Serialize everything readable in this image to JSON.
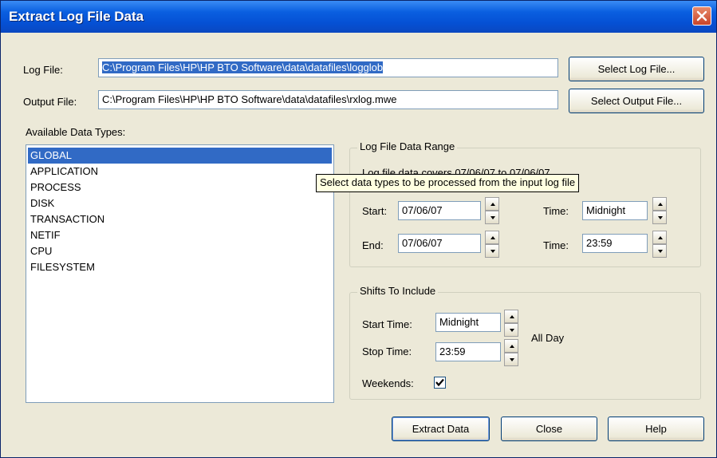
{
  "window": {
    "title": "Extract Log File Data"
  },
  "log_file": {
    "label": "Log File:",
    "value": "C:\\Program Files\\HP\\HP BTO Software\\data\\datafiles\\logglob",
    "button": "Select Log File..."
  },
  "output_file": {
    "label": "Output File:",
    "value": "C:\\Program Files\\HP\\HP BTO Software\\data\\datafiles\\rxlog.mwe",
    "button": "Select Output File..."
  },
  "data_types": {
    "label": "Available Data Types:",
    "items": [
      "GLOBAL",
      "APPLICATION",
      "PROCESS",
      "DISK",
      "TRANSACTION",
      "NETIF",
      "CPU",
      "FILESYSTEM"
    ],
    "selected": "GLOBAL"
  },
  "range": {
    "legend": "Log File Data Range",
    "summary": "Log file data covers 07/06/07 to 07/06/07",
    "start_label": "Start:",
    "start_value": "07/06/07",
    "end_label": "End:",
    "end_value": "07/06/07",
    "time_label": "Time:",
    "start_time": "Midnight",
    "end_time": "23:59"
  },
  "tooltip": "Select data types to be processed from the input log file",
  "shifts": {
    "legend": "Shifts To Include",
    "start_label": "Start Time:",
    "start_value": "Midnight",
    "stop_label": "Stop Time:",
    "stop_value": "23:59",
    "all_day": "All Day",
    "weekends_label": "Weekends:",
    "weekends_checked": true
  },
  "buttons": {
    "extract": "Extract Data",
    "close": "Close",
    "help": "Help"
  },
  "colors": {
    "selection": "#316ac5",
    "dialog_bg": "#ece9d8",
    "title_bar": "#0550d4"
  }
}
